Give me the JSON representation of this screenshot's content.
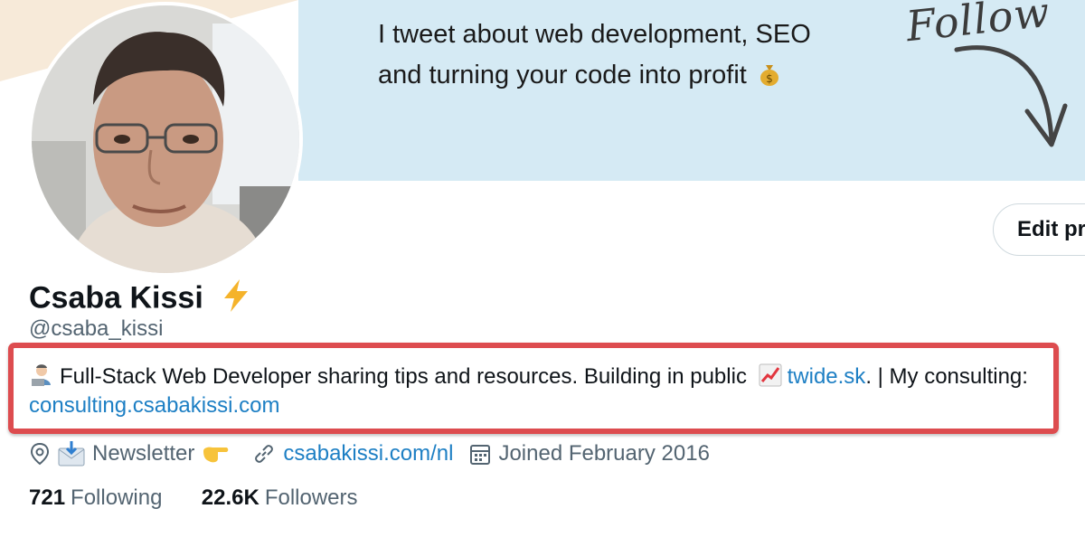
{
  "banner": {
    "line1": "I tweet about web development, SEO",
    "line2": "and turning your code into profit",
    "follow_word": "Follow"
  },
  "profile": {
    "name": "Csaba Kissi",
    "handle": "@csaba_kissi",
    "edit_button_label": "Edit pr"
  },
  "bio": {
    "text_part1": "Full-Stack Web Developer sharing tips and resources. Building in public",
    "link1": "twide.sk",
    "text_part2": ". | My consulting:",
    "link2": "consulting.csabakissi.com"
  },
  "meta": {
    "location": "Newsletter",
    "website": "csabakissi.com/nl",
    "joined": "Joined February 2016"
  },
  "stats": {
    "following_count": "721",
    "following_label": "Following",
    "followers_count": "22.6K",
    "followers_label": "Followers"
  },
  "colors": {
    "banner_bg": "#d5eaf4",
    "link": "#1d7fc4",
    "highlight_border": "#dd4c4f",
    "muted_text": "#536471"
  },
  "icons": [
    "money-bag-emoji",
    "lightning-emoji",
    "technologist-emoji",
    "chart-increasing-emoji",
    "location-icon",
    "envelope-emoji",
    "pointing-hand-emoji",
    "link-icon",
    "calendar-icon",
    "arrow-icon"
  ]
}
